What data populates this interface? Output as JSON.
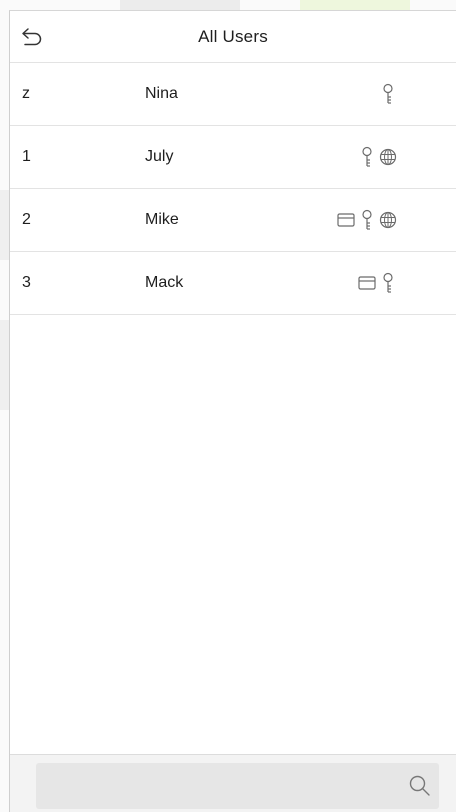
{
  "header": {
    "title": "All Users",
    "back_icon": "back-arrow-icon"
  },
  "users": [
    {
      "id": "z",
      "name": "Nina",
      "verify_icons": [
        "password-key-icon"
      ]
    },
    {
      "id": "1",
      "name": "July",
      "verify_icons": [
        "password-key-icon",
        "face-icon"
      ]
    },
    {
      "id": "2",
      "name": "Mike",
      "verify_icons": [
        "card-icon",
        "password-key-icon",
        "face-icon"
      ]
    },
    {
      "id": "3",
      "name": "Mack",
      "verify_icons": [
        "card-icon",
        "password-key-icon"
      ]
    }
  ],
  "search": {
    "value": "",
    "placeholder": "",
    "icon": "search-icon"
  },
  "colors": {
    "text": "#1e1e1e",
    "icon": "#6b6b6b",
    "divider": "#e3e3e3",
    "footer_bg": "#f3f3f3",
    "search_bg": "#e6e6e6"
  }
}
